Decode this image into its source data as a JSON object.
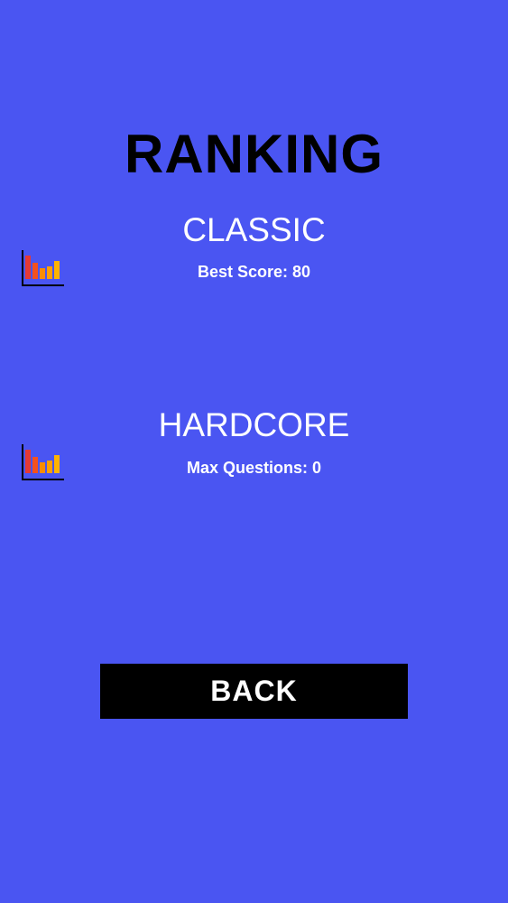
{
  "screen": {
    "title": "RANKING",
    "background_color": "#4a55f2"
  },
  "modes": [
    {
      "name": "CLASSIC",
      "stat_text": "Best Score: 80",
      "icon": "bar-chart-icon"
    },
    {
      "name": "HARDCORE",
      "stat_text": "Max Questions: 0",
      "icon": "bar-chart-icon"
    }
  ],
  "back_button": {
    "label": "BACK"
  },
  "colors": {
    "bar_red": "#e53935",
    "bar_orange": "#f4511e",
    "bar_amber": "#ffb300",
    "axis": "#000000"
  }
}
